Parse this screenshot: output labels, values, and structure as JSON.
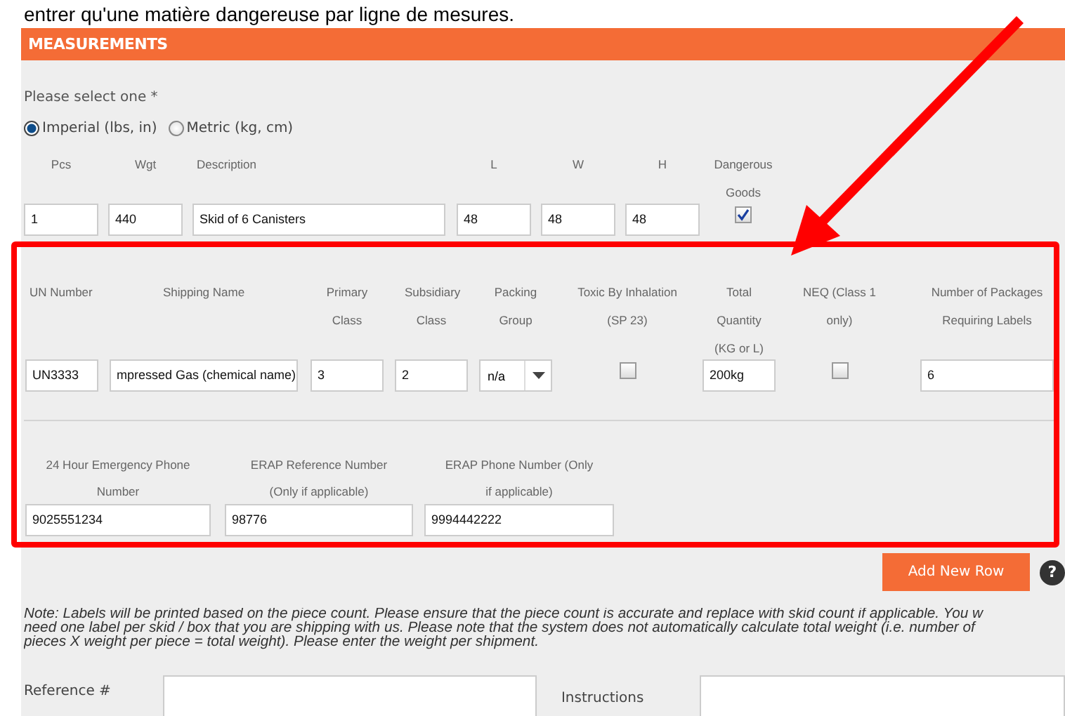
{
  "top_text": "entrer qu'une matière dangereuse par ligne de mesures.",
  "section": {
    "title": "MEASUREMENTS"
  },
  "unit_prompt": "Please select one *",
  "units": [
    {
      "label": "Imperial (lbs, in)",
      "selected": true
    },
    {
      "label": "Metric (kg, cm)",
      "selected": false
    }
  ],
  "item_columns": [
    {
      "kind": "text",
      "label": "Pcs",
      "value": "1"
    },
    {
      "kind": "text",
      "label": "Wgt",
      "value": "440"
    },
    {
      "kind": "text",
      "label": "Description",
      "value": "Skid of 6 Canisters"
    },
    {
      "kind": "text",
      "label": "L",
      "value": "48"
    },
    {
      "kind": "text",
      "label": "W",
      "value": "48"
    },
    {
      "kind": "text",
      "label": "H",
      "value": "48"
    },
    {
      "kind": "checkbox",
      "label": "Dangerous Goods",
      "checked": true
    }
  ],
  "dg_columns": [
    {
      "kind": "text",
      "label": "UN Number",
      "value": "UN3333"
    },
    {
      "kind": "text",
      "label": "Shipping Name",
      "value": "mpressed Gas (chemical name)"
    },
    {
      "kind": "text",
      "label": "Primary Class",
      "value": "3"
    },
    {
      "kind": "text",
      "label": "Subsidiary Class",
      "value": "2"
    },
    {
      "kind": "select",
      "label": "Packing Group",
      "value": "n/a"
    },
    {
      "kind": "checkbox",
      "label": "Toxic By Inhalation (SP 23)",
      "checked": false
    },
    {
      "kind": "text",
      "label": "Total Quantity (KG or L)",
      "value": "200kg"
    },
    {
      "kind": "checkbox",
      "label": "NEQ (Class 1 only)",
      "checked": false
    },
    {
      "kind": "text",
      "label": "Number of Packages Requiring Labels",
      "value": "6"
    }
  ],
  "phone_columns": [
    {
      "label": "24 Hour Emergency Phone Number",
      "value": "9025551234"
    },
    {
      "label": "ERAP Reference Number (Only if applicable)",
      "value": "98776"
    },
    {
      "label": "ERAP Phone Number (Only if applicable)",
      "value": "9994442222"
    }
  ],
  "add_button": "Add New Row",
  "help": "?",
  "note": "Note: Labels will be printed based on the piece count. Please ensure that the piece count is accurate and replace with skid count if applicable. You w\nneed one label per skid / box that you are shipping with us. Please note that the system does not automatically calculate total weight (i.e. number of\npieces X weight per piece = total weight). Please enter the weight per shipment.",
  "reference_label": "Reference #",
  "instructions_label": "Instructions"
}
